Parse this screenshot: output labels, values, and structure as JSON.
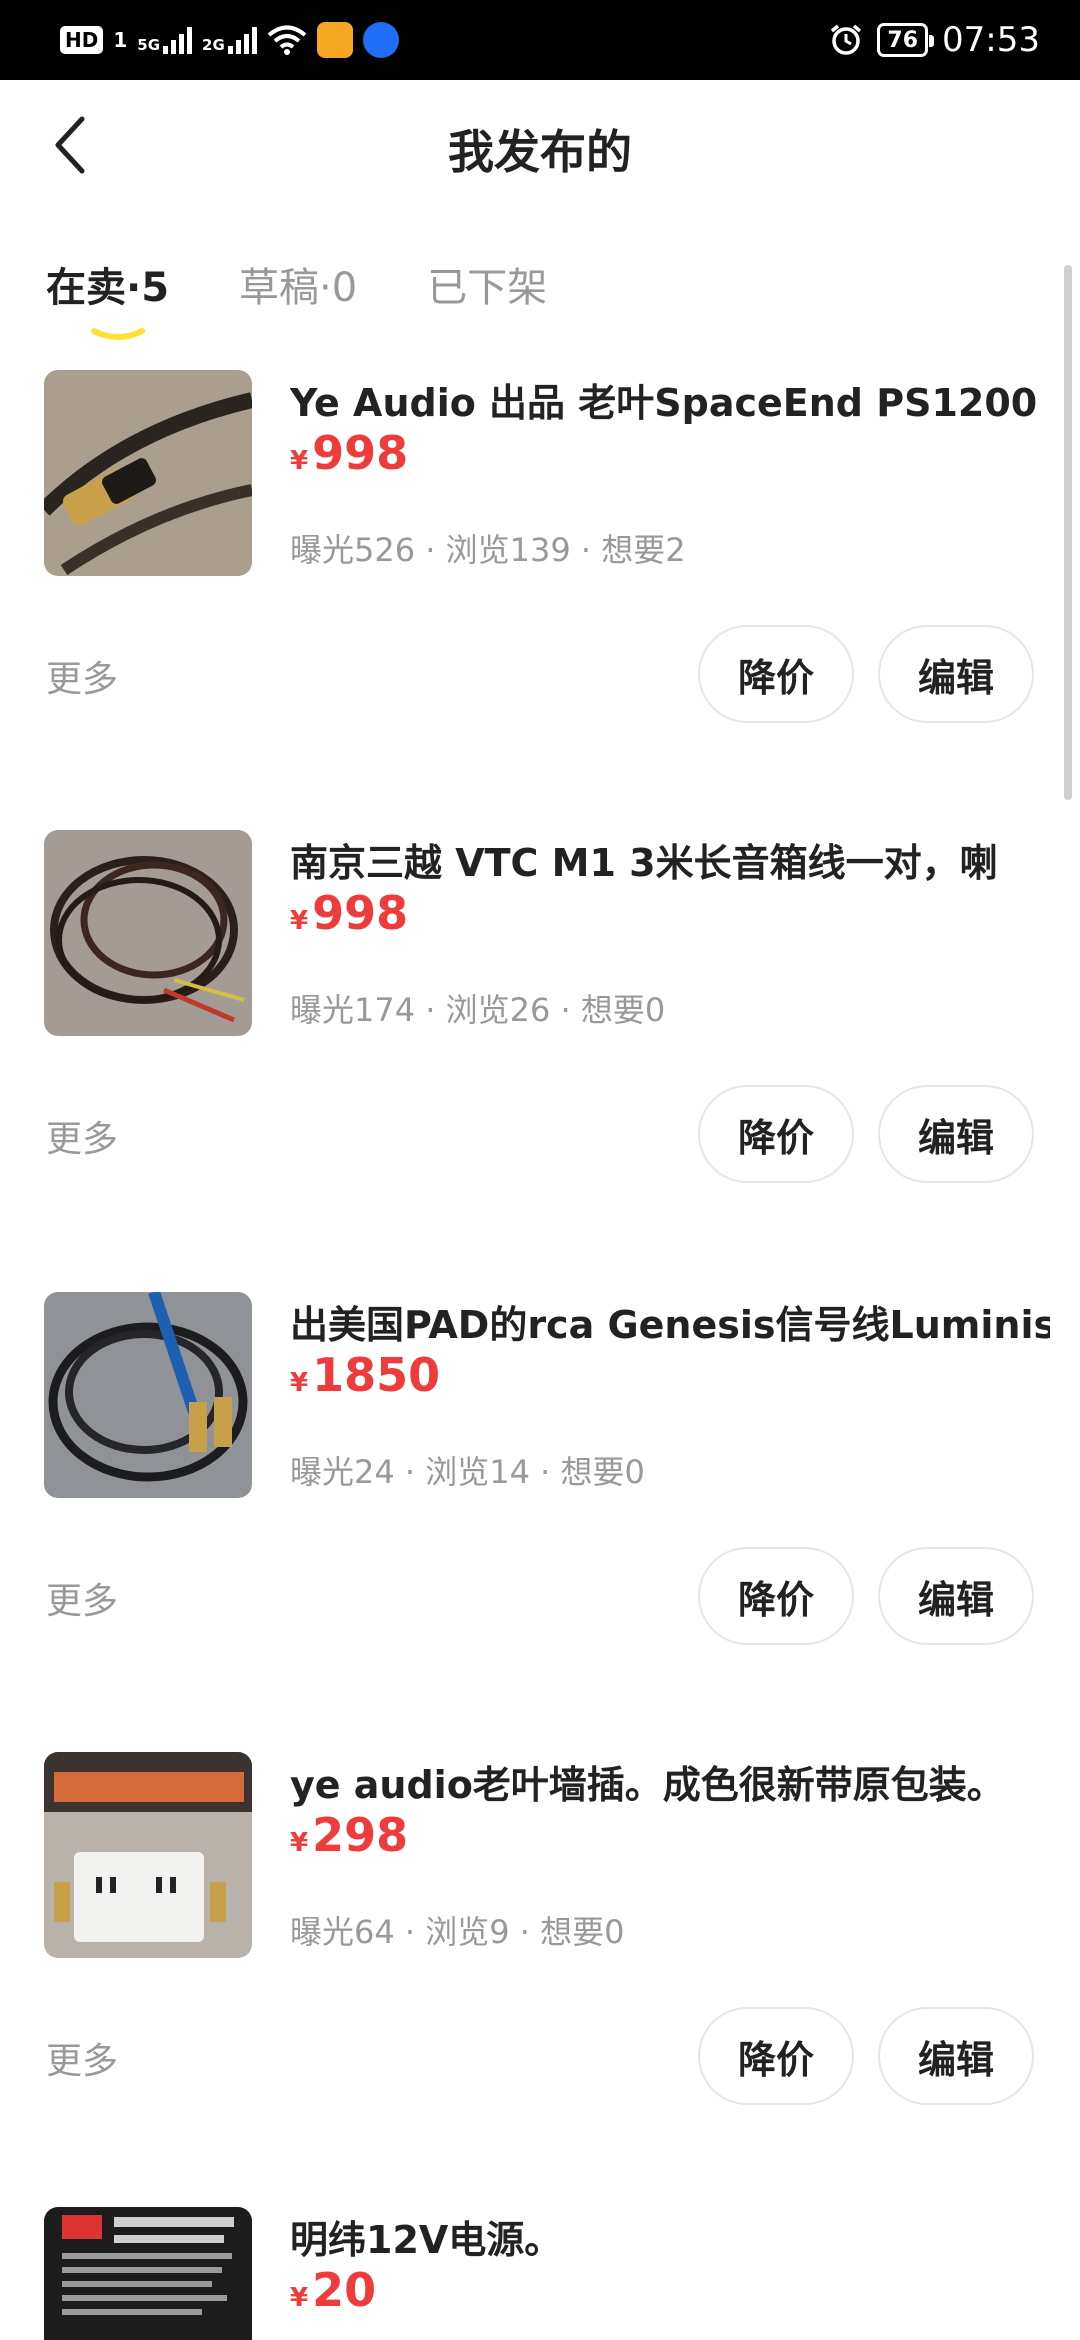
{
  "statusbar": {
    "hd": "HD",
    "sim1": "1",
    "net1": "5G",
    "net2": "2G",
    "battery": "76",
    "time": "07:53"
  },
  "header": {
    "title": "我发布的",
    "back_icon": "chevron-left-icon"
  },
  "tabs": [
    {
      "label": "在卖",
      "sep": "·",
      "count": "5"
    },
    {
      "label": "草稿",
      "sep": "·",
      "count": "0"
    },
    {
      "label": "已下架"
    }
  ],
  "items": [
    {
      "title": "Ye Audio 出品 老叶SpaceEnd PS1200",
      "currency": "¥",
      "price": "998",
      "stats": "曝光526 · 浏览139 · 想要2",
      "more": "更多",
      "btn_price_down": "降价",
      "btn_edit": "编辑"
    },
    {
      "title": "南京三越 VTC M1 3米长音箱线一对，喇",
      "currency": "¥",
      "price": "998",
      "stats": "曝光174 · 浏览26 · 想要0",
      "more": "更多",
      "btn_price_down": "降价",
      "btn_edit": "编辑"
    },
    {
      "title": "出美国PAD的rca Genesis信号线Luminist",
      "currency": "¥",
      "price": "1850",
      "stats": "曝光24 · 浏览14 · 想要0",
      "more": "更多",
      "btn_price_down": "降价",
      "btn_edit": "编辑"
    },
    {
      "title": "ye audio老叶墙插。成色很新带原包装。",
      "currency": "¥",
      "price": "298",
      "stats": "曝光64 · 浏览9 · 想要0",
      "more": "更多",
      "btn_price_down": "降价",
      "btn_edit": "编辑"
    },
    {
      "title": "明纬12V电源。",
      "currency": "¥",
      "price": "20"
    }
  ],
  "colors": {
    "price": "#ee3b3b",
    "tab_underline": "#ffe033",
    "muted": "#999999"
  }
}
